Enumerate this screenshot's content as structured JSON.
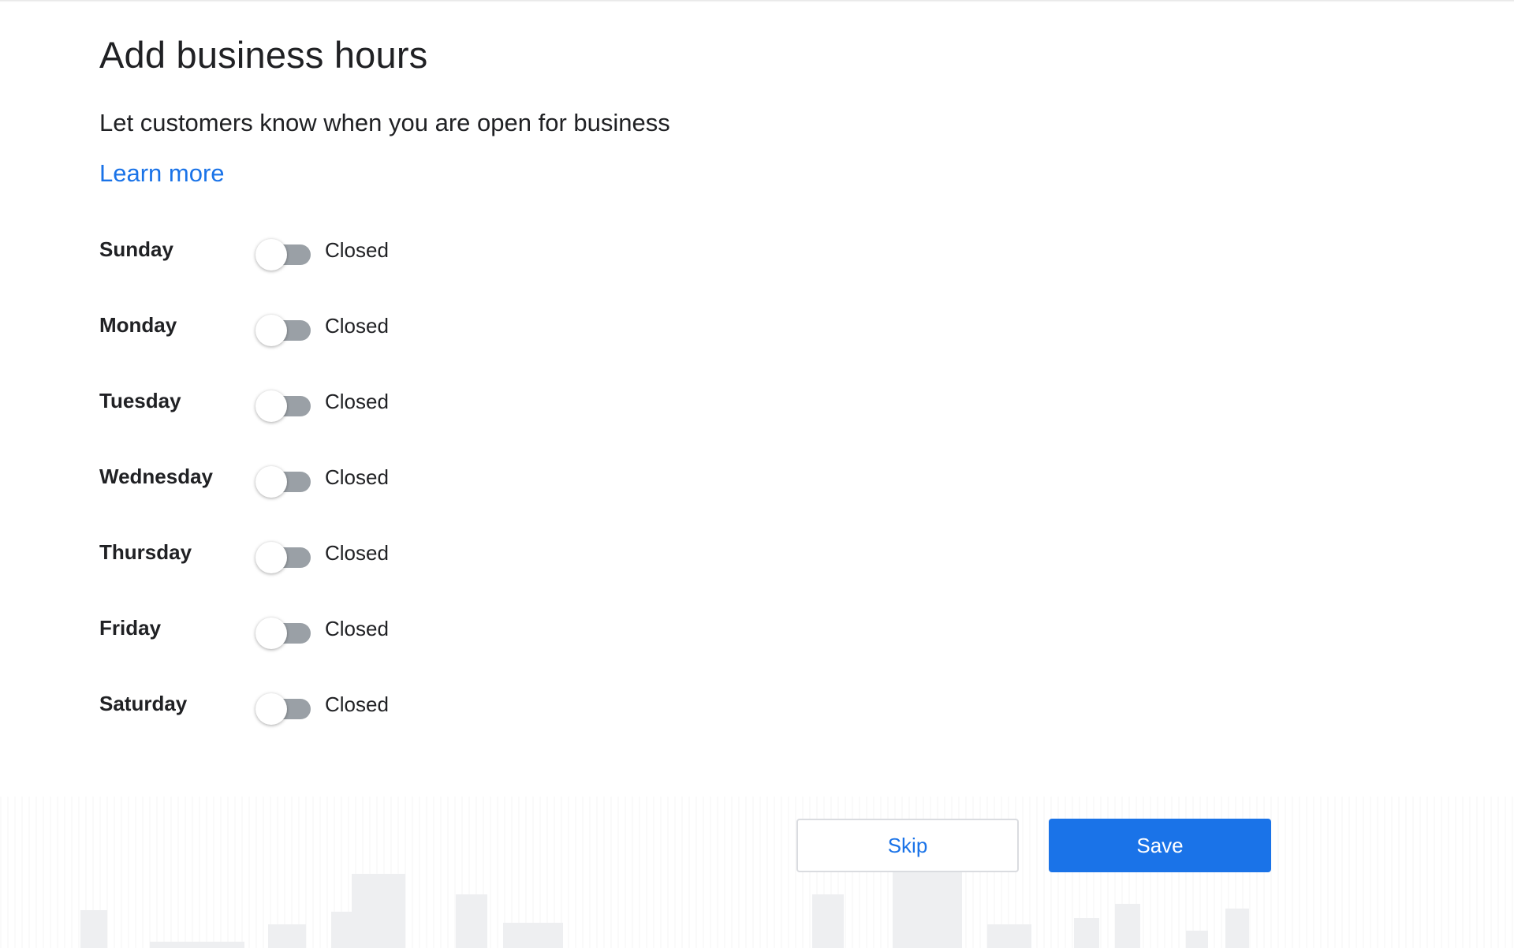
{
  "header": {
    "title": "Add business hours",
    "subtitle": "Let customers know when you are open for business",
    "learn_more": "Learn more"
  },
  "days": [
    {
      "name": "Sunday",
      "status": "Closed",
      "open": false
    },
    {
      "name": "Monday",
      "status": "Closed",
      "open": false
    },
    {
      "name": "Tuesday",
      "status": "Closed",
      "open": false
    },
    {
      "name": "Wednesday",
      "status": "Closed",
      "open": false
    },
    {
      "name": "Thursday",
      "status": "Closed",
      "open": false
    },
    {
      "name": "Friday",
      "status": "Closed",
      "open": false
    },
    {
      "name": "Saturday",
      "status": "Closed",
      "open": false
    }
  ],
  "actions": {
    "skip_label": "Skip",
    "save_label": "Save"
  },
  "colors": {
    "accent": "#1a73e8",
    "toggle_off_track": "#9aa0a6",
    "text": "#202124"
  }
}
